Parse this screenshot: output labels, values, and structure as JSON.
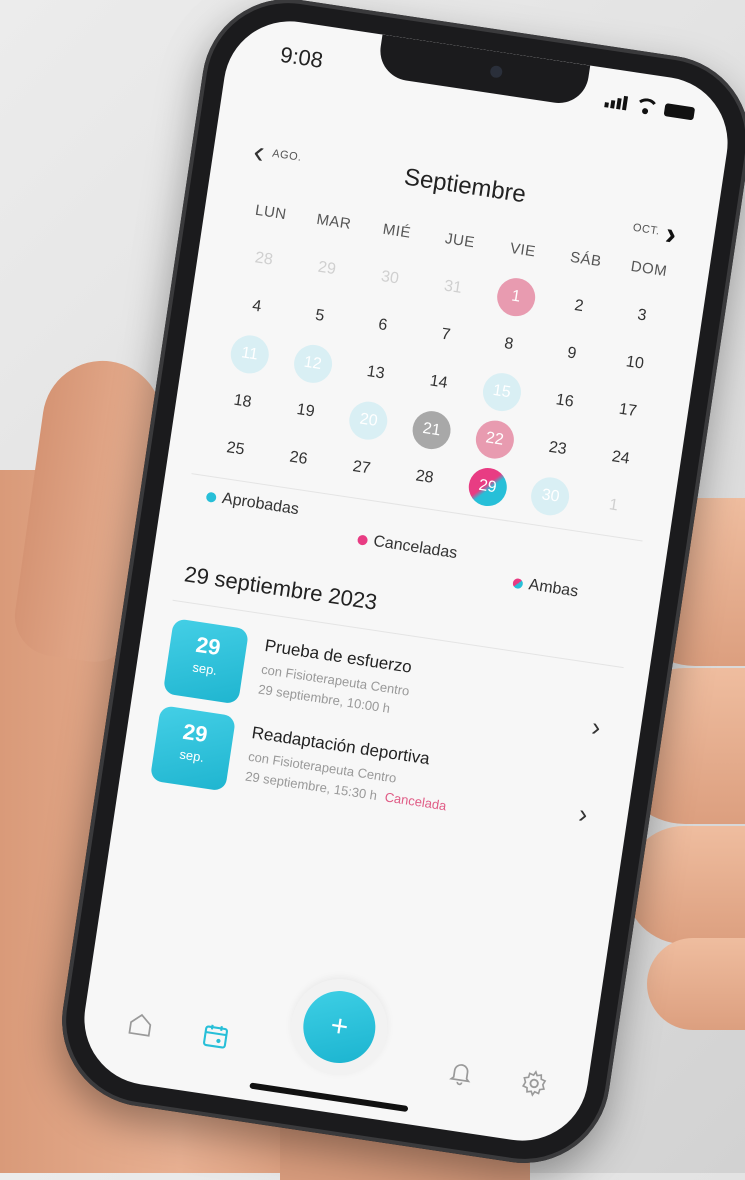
{
  "status_bar": {
    "time": "9:08"
  },
  "month_nav": {
    "prev_label": "AGO.",
    "title": "Septiembre",
    "next_label": "OCT."
  },
  "weekdays": [
    "LUN",
    "MAR",
    "MIÉ",
    "JUE",
    "VIE",
    "SÁB",
    "DOM"
  ],
  "weeks": [
    [
      {
        "d": "28",
        "s": "other"
      },
      {
        "d": "29",
        "s": "other"
      },
      {
        "d": "30",
        "s": "other"
      },
      {
        "d": "31",
        "s": "other"
      },
      {
        "d": "1",
        "s": "cancelled"
      },
      {
        "d": "2",
        "s": ""
      },
      {
        "d": "3",
        "s": ""
      }
    ],
    [
      {
        "d": "4",
        "s": ""
      },
      {
        "d": "5",
        "s": ""
      },
      {
        "d": "6",
        "s": ""
      },
      {
        "d": "7",
        "s": ""
      },
      {
        "d": "8",
        "s": ""
      },
      {
        "d": "9",
        "s": ""
      },
      {
        "d": "10",
        "s": ""
      }
    ],
    [
      {
        "d": "11",
        "s": "approved"
      },
      {
        "d": "12",
        "s": "approved"
      },
      {
        "d": "13",
        "s": ""
      },
      {
        "d": "14",
        "s": ""
      },
      {
        "d": "15",
        "s": "approved"
      },
      {
        "d": "16",
        "s": ""
      },
      {
        "d": "17",
        "s": ""
      }
    ],
    [
      {
        "d": "18",
        "s": ""
      },
      {
        "d": "19",
        "s": ""
      },
      {
        "d": "20",
        "s": "approved"
      },
      {
        "d": "21",
        "s": "grey"
      },
      {
        "d": "22",
        "s": "cancelled"
      },
      {
        "d": "23",
        "s": ""
      },
      {
        "d": "24",
        "s": ""
      }
    ],
    [
      {
        "d": "25",
        "s": ""
      },
      {
        "d": "26",
        "s": ""
      },
      {
        "d": "27",
        "s": ""
      },
      {
        "d": "28",
        "s": ""
      },
      {
        "d": "29",
        "s": "both"
      },
      {
        "d": "30",
        "s": "approved"
      },
      {
        "d": "1",
        "s": "other"
      }
    ]
  ],
  "legend": {
    "approved": "Aprobadas",
    "cancelled": "Canceladas",
    "both": "Ambas"
  },
  "selected_date": "29 septiembre 2023",
  "appointments": [
    {
      "day": "29",
      "month": "sep.",
      "title": "Prueba de esfuerzo",
      "with": "con Fisioterapeuta Centro",
      "time": "29 septiembre, 10:00 h",
      "status": ""
    },
    {
      "day": "29",
      "month": "sep.",
      "title": "Readaptación deportiva",
      "with": "con Fisioterapeuta Centro",
      "time": "29 septiembre, 15:30 h",
      "status": "Cancelada"
    }
  ],
  "fab_label": "+",
  "colors": {
    "accent": "#27bfd8",
    "cancel": "#e83c83",
    "approved_light": "#d9eff4"
  },
  "icons": {
    "home": "home-icon",
    "calendar": "calendar-icon",
    "bell": "bell-icon",
    "settings": "gear-icon"
  }
}
